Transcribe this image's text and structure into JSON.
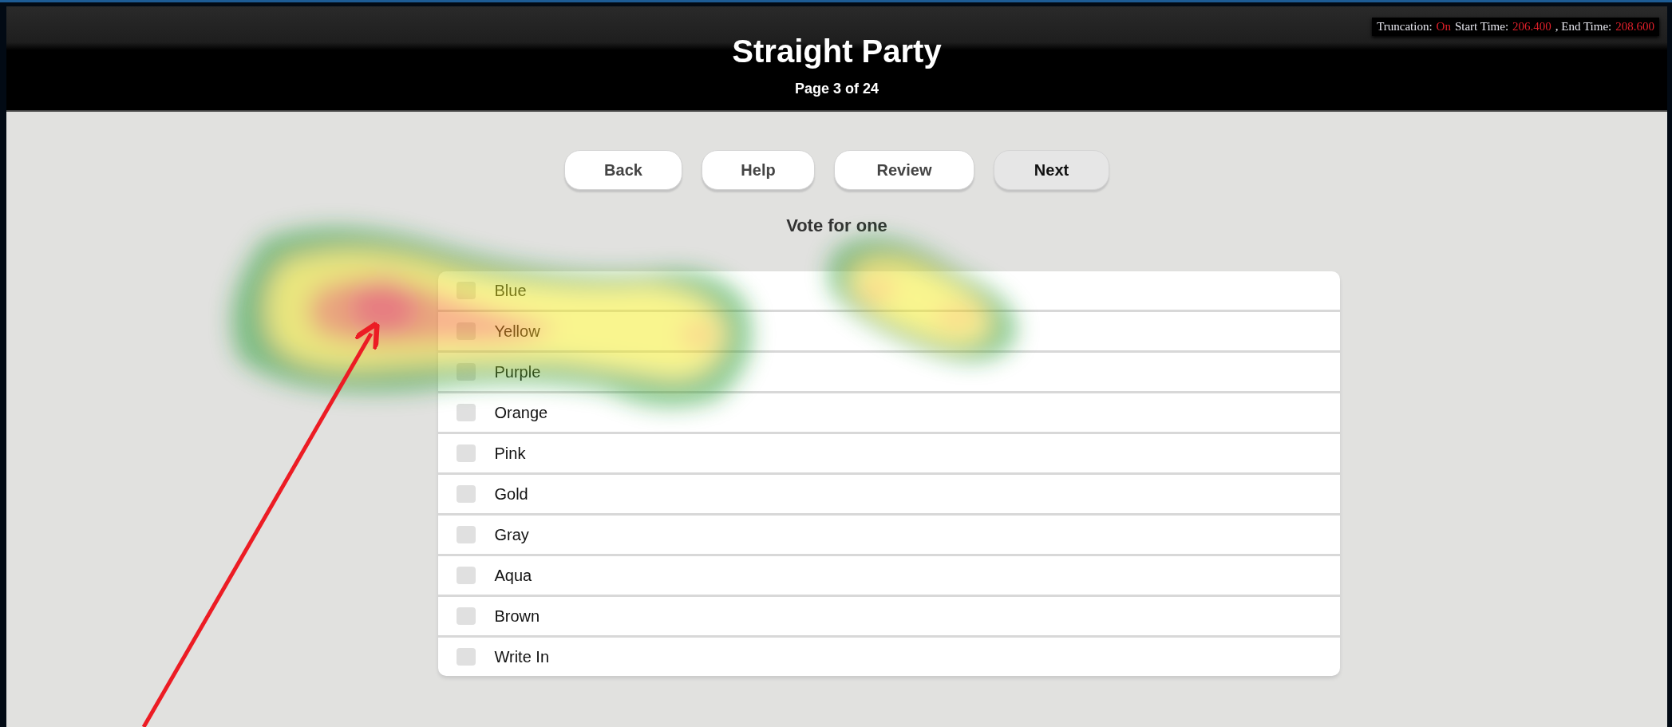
{
  "header": {
    "title": "Straight Party",
    "page": "Page 3 of 24",
    "truncation": [
      {
        "text": "Truncation:",
        "highlight": false
      },
      {
        "text": "On",
        "highlight": true
      },
      {
        "text": "Start Time:",
        "highlight": false
      },
      {
        "text": "206.400",
        "highlight": true
      },
      {
        "text": ", End Time:",
        "highlight": false
      },
      {
        "text": "208.600",
        "highlight": true
      }
    ]
  },
  "buttons": [
    {
      "label": "Back",
      "kind": "plain"
    },
    {
      "label": "Help",
      "kind": "plain"
    },
    {
      "label": "Review",
      "kind": "plain"
    },
    {
      "label": "Next",
      "kind": "default"
    }
  ],
  "instruction": "Vote for one",
  "options": [
    {
      "label": "Blue",
      "checked": false
    },
    {
      "label": "Yellow",
      "checked": false
    },
    {
      "label": "Purple",
      "checked": false
    },
    {
      "label": "Orange",
      "checked": false
    },
    {
      "label": "Pink",
      "checked": false
    },
    {
      "label": "Gold",
      "checked": false
    },
    {
      "label": "Gray",
      "checked": false
    },
    {
      "label": "Aqua",
      "checked": false
    },
    {
      "label": "Brown",
      "checked": false
    },
    {
      "label": "Write In",
      "checked": false
    }
  ],
  "overlay": {
    "heatmap": true,
    "arrow": true
  }
}
